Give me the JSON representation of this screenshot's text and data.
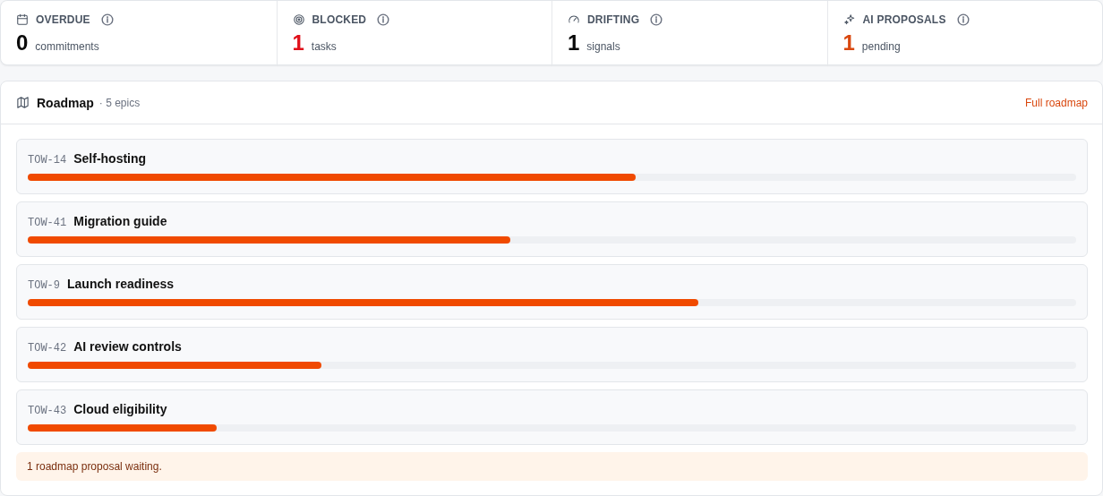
{
  "stats": [
    {
      "label": "OVERDUE",
      "count": "0",
      "unit": "commitments",
      "color": "#0a0a0a"
    },
    {
      "label": "BLOCKED",
      "count": "1",
      "unit": "tasks",
      "color": "#e0101a"
    },
    {
      "label": "DRIFTING",
      "count": "1",
      "unit": "signals",
      "color": "#0a0a0a"
    },
    {
      "label": "AI PROPOSALS",
      "count": "1",
      "unit": "pending",
      "color": "#d9480f"
    }
  ],
  "roadmap": {
    "title": "Roadmap",
    "meta": "· 5 epics",
    "link": "Full roadmap",
    "epics": [
      {
        "key": "TOW-14",
        "name": "Self-hosting",
        "level": 0.58
      },
      {
        "key": "TOW-41",
        "name": "Migration guide",
        "level": 0.46
      },
      {
        "key": "TOW-9",
        "name": "Launch readiness",
        "level": 0.64
      },
      {
        "key": "TOW-42",
        "name": "AI review controls",
        "level": 0.28
      },
      {
        "key": "TOW-43",
        "name": "Cloud eligibility",
        "level": 0.18
      }
    ],
    "notice": "1 roadmap proposal waiting."
  }
}
